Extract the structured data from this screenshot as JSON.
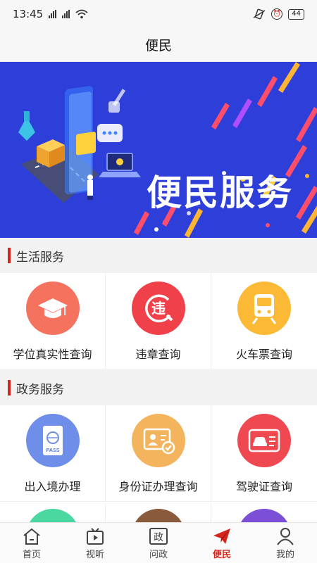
{
  "status_bar": {
    "time": "13:45",
    "battery": "44"
  },
  "header": {
    "title": "便民"
  },
  "banner": {
    "text": "便民服务",
    "bg_color": "#2e3fd9"
  },
  "sections": [
    {
      "title": "生活服务",
      "items": [
        {
          "label": "学位真实性查询",
          "icon": "graduation-cap-icon",
          "color": "#f4725e"
        },
        {
          "label": "违章查询",
          "icon": "violation-icon",
          "color": "#f0414b"
        },
        {
          "label": "火车票查询",
          "icon": "train-icon",
          "color": "#fbb935"
        }
      ]
    },
    {
      "title": "政务服务",
      "items": [
        {
          "label": "出入境办理",
          "icon": "passport-icon",
          "color": "#6f8ee9"
        },
        {
          "label": "身份证办理查询",
          "icon": "id-card-icon",
          "color": "#f4b45d"
        },
        {
          "label": "驾驶证查询",
          "icon": "driver-license-icon",
          "color": "#f04850"
        }
      ]
    }
  ],
  "partial_row_colors": [
    "#4bd7a0",
    "#8a5a3c",
    "#7b4fd6"
  ],
  "bottom_nav": [
    {
      "label": "首页",
      "icon": "home-icon"
    },
    {
      "label": "视听",
      "icon": "tv-icon"
    },
    {
      "label": "问政",
      "icon": "politics-icon",
      "glyph": "政"
    },
    {
      "label": "便民",
      "icon": "paper-plane-icon",
      "active": true
    },
    {
      "label": "我的",
      "icon": "user-icon"
    }
  ],
  "accent_color": "#d4261c"
}
